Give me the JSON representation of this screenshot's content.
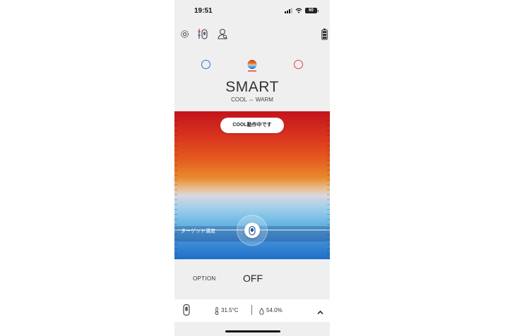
{
  "status_bar": {
    "time": "19:51",
    "battery": "60"
  },
  "toolbar": {
    "icons": [
      "settings-icon",
      "device-sliders-icon",
      "user-settings-icon",
      "device-battery-icon"
    ]
  },
  "modes": {
    "selected": "smart",
    "cool_color": "#2c6fd6",
    "warm_color": "#e0413a"
  },
  "mode": {
    "title": "SMART",
    "subtitle": "COOL ⇔ WARM"
  },
  "panel": {
    "status_pill": "COOL動作中です",
    "target_label": "ターゲット温度",
    "gradient_top_color": "#c3141b",
    "gradient_bottom_color": "#1f6ec8"
  },
  "option": {
    "label": "OPTION",
    "value": "OFF"
  },
  "bottom_bar": {
    "temperature": "31.5°C",
    "humidity": "54.0%"
  }
}
